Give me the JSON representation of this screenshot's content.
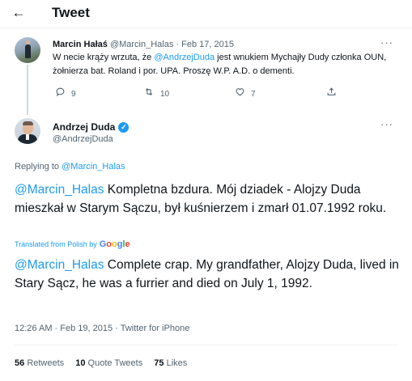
{
  "header": {
    "back_icon": "arrow-left-icon",
    "title": "Tweet"
  },
  "original_tweet": {
    "author_name": "Marcin Hałaś",
    "author_handle": "@Marcin_Halas",
    "separator": "·",
    "date": "Feb 17, 2015",
    "more_icon": "more-icon",
    "text_before_mention": "W necie krąży wrzuta, że ",
    "mention": "@AndrzejDuda",
    "text_after_mention": " jest wnukiem Mychajły Dudy członka OUN, żołnierza bat. Roland i por. UPA. Proszę W.P. A.D. o dementi.",
    "actions": {
      "reply": {
        "icon": "reply-icon",
        "count": "9"
      },
      "retweet": {
        "icon": "retweet-icon",
        "count": "10"
      },
      "like": {
        "icon": "heart-icon",
        "count": "7"
      },
      "share": {
        "icon": "share-icon"
      }
    }
  },
  "main_tweet": {
    "author_name": "Andrzej Duda",
    "verified_icon": "verified-badge-icon",
    "author_handle": "@AndrzejDuda",
    "more_icon": "more-icon",
    "replying_prefix": "Replying to ",
    "replying_to": "@Marcin_Halas",
    "mention": "@Marcin_Halas",
    "original_text": " Kompletna bzdura. Mój dziadek - Alojzy Duda mieszkał w Starym Sączu, był kuśnierzem i zmarł 01.07.1992 roku.",
    "translated_label": "Translated from Polish by",
    "translator": "Google",
    "translated_text": " Complete crap. My grandfather, Alojzy Duda, lived in Stary Sącz, he was a furrier and died on July 1, 1992.",
    "time": "12:26 AM",
    "separator": "·",
    "date": "Feb 19, 2015",
    "source": "Twitter for iPhone"
  },
  "stats": {
    "retweets_count": "56",
    "retweets_label": "Retweets",
    "quotes_count": "10",
    "quotes_label": "Quote Tweets",
    "likes_count": "75",
    "likes_label": "Likes"
  },
  "colors": {
    "link": "#1d9bf0",
    "text": "#0f1419",
    "muted": "#536471"
  }
}
